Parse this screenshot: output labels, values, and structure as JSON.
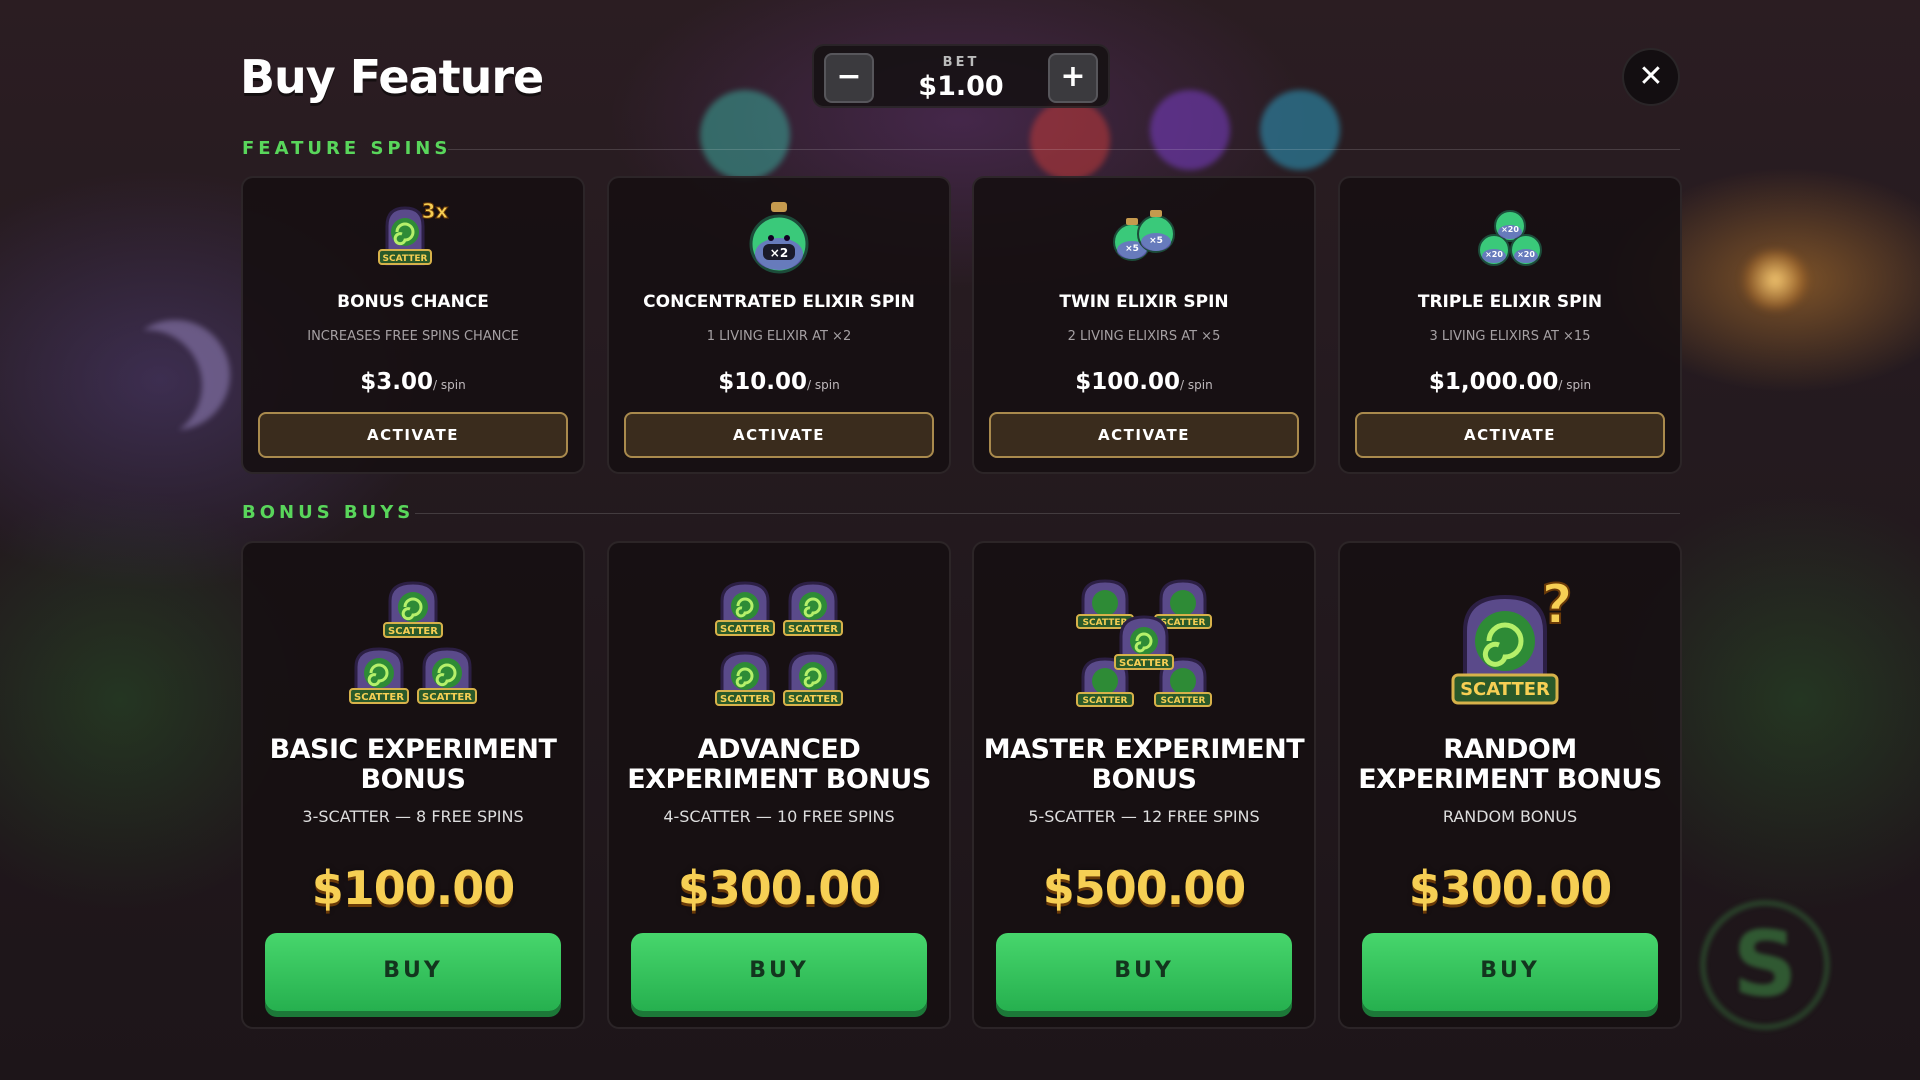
{
  "header": {
    "title": "Buy Feature",
    "bet_label": "BET",
    "bet_value": "$1.00",
    "minus_label": "−",
    "plus_label": "+",
    "close_label": "✕"
  },
  "sections": {
    "feature_spins": "FEATURE SPINS",
    "bonus_buys": "BONUS BUYS"
  },
  "feature_spins": [
    {
      "name": "BONUS CHANCE",
      "desc": "INCREASES FREE SPINS CHANCE",
      "price": "$3.00",
      "unit": "/ spin",
      "button": "ACTIVATE",
      "icon": "scatter-3x-icon",
      "badge": "3x",
      "scatter": "SCATTER"
    },
    {
      "name": "CONCENTRATED ELIXIR SPIN",
      "desc": "1 LIVING ELIXIR AT ×2",
      "price": "$10.00",
      "unit": "/ spin",
      "button": "ACTIVATE",
      "icon": "elixir-x2-icon",
      "badge": "×2"
    },
    {
      "name": "TWIN ELIXIR SPIN",
      "desc": "2 LIVING ELIXIRS AT ×5",
      "price": "$100.00",
      "unit": "/ spin",
      "button": "ACTIVATE",
      "icon": "twin-elixir-icon",
      "badge": "×5"
    },
    {
      "name": "TRIPLE ELIXIR SPIN",
      "desc": "3 LIVING ELIXIRS AT ×15",
      "price": "$1,000.00",
      "unit": "/ spin",
      "button": "ACTIVATE",
      "icon": "triple-elixir-icon",
      "badge": "×20"
    }
  ],
  "bonus_buys": [
    {
      "name_line1": "BASIC EXPERIMENT",
      "name_line2": "BONUS",
      "desc": "3-SCATTER — 8 FREE SPINS",
      "price": "$100.00",
      "button": "BUY",
      "icon": "three-scatter-icon",
      "scatter": "SCATTER"
    },
    {
      "name_line1": "ADVANCED",
      "name_line2": "EXPERIMENT BONUS",
      "desc": "4-SCATTER — 10 FREE SPINS",
      "price": "$300.00",
      "button": "BUY",
      "icon": "four-scatter-icon",
      "scatter": "SCATTER"
    },
    {
      "name_line1": "MASTER EXPERIMENT",
      "name_line2": "BONUS",
      "desc": "5-SCATTER — 12 FREE SPINS",
      "price": "$500.00",
      "button": "BUY",
      "icon": "five-scatter-icon",
      "scatter": "SCATTER"
    },
    {
      "name_line1": "RANDOM",
      "name_line2": "EXPERIMENT BONUS",
      "desc": "RANDOM BONUS",
      "price": "$300.00",
      "button": "BUY",
      "icon": "random-scatter-icon",
      "scatter": "SCATTER",
      "badge": "?"
    }
  ],
  "colors": {
    "accent_green": "#59d65b",
    "price_gold": "#f6cf54",
    "buy_green": "#2fbf58",
    "activate_border": "#a98a4d"
  }
}
